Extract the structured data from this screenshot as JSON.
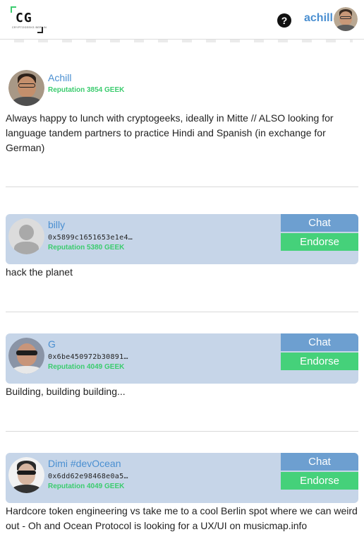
{
  "header": {
    "logo_mark": "CG",
    "logo_sub": "CRYPTOGEEKS BERLIN",
    "help_icon": "?",
    "username": "achill"
  },
  "profile": {
    "name": "Achill",
    "reputation_label": "Reputation",
    "reputation_value": "3854 GEEK",
    "bio": "Always happy to lunch with cryptogeeks, ideally in Mitte // ALSO looking for language tandem partners to practice Hindi and Spanish (in exchange for German)"
  },
  "buttons": {
    "chat": "Chat",
    "endorse": "Endorse"
  },
  "users": [
    {
      "name": "billy",
      "address": "0x5899c1651653e1e4…",
      "reputation_label": "Reputation",
      "reputation_value": "5380 GEEK",
      "bio": "hack the planet"
    },
    {
      "name": "G",
      "address": "0x6be450972b30891…",
      "reputation_label": "Reputation",
      "reputation_value": "4049 GEEK",
      "bio": "Building, building building..."
    },
    {
      "name": "Dimi #devOcean",
      "address": "0x6dd62e98468e0a5…",
      "reputation_label": "Reputation",
      "reputation_value": "4049 GEEK",
      "bio": "Hardcore token engineering vs take me to a cool Berlin spot where we can weird out - Oh and Ocean Protocol is looking for a UX/UI on musicmap.info"
    }
  ],
  "icons": {
    "help": "question-circle-icon",
    "avatar_default": "user-silhouette-icon"
  },
  "colors": {
    "link_blue": "#4a8fd1",
    "reputation_green": "#3ccc6f",
    "card_bg": "#c6d5e8",
    "chat_button": "#6d9fd0",
    "endorse_button": "#45d17a"
  }
}
